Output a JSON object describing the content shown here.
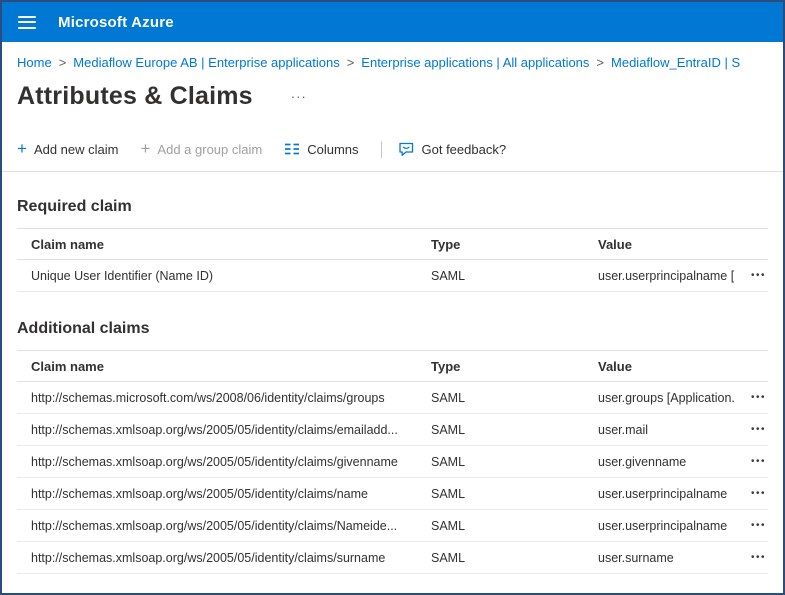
{
  "topbar": {
    "title": "Microsoft Azure"
  },
  "icons": {
    "add": "+",
    "more": "•••",
    "title_more": "···"
  },
  "breadcrumb": {
    "separator": ">",
    "items": [
      {
        "label": "Home"
      },
      {
        "label": "Mediaflow Europe AB | Enterprise applications"
      },
      {
        "label": "Enterprise applications | All applications"
      },
      {
        "label": "Mediaflow_EntraID | S"
      }
    ]
  },
  "page": {
    "title": "Attributes & Claims"
  },
  "toolbar": {
    "add_new_claim": "Add new claim",
    "add_group_claim": "Add a group claim",
    "columns": "Columns",
    "feedback": "Got feedback?"
  },
  "required_claim": {
    "section_title": "Required claim",
    "headers": {
      "claim_name": "Claim name",
      "type": "Type",
      "value": "Value"
    },
    "rows": [
      {
        "claim_name": "Unique User Identifier (Name ID)",
        "type": "SAML",
        "value": "user.userprincipalname [..."
      }
    ]
  },
  "additional_claims": {
    "section_title": "Additional claims",
    "headers": {
      "claim_name": "Claim name",
      "type": "Type",
      "value": "Value"
    },
    "rows": [
      {
        "claim_name": "http://schemas.microsoft.com/ws/2008/06/identity/claims/groups",
        "type": "SAML",
        "value": "user.groups [Application..."
      },
      {
        "claim_name": "http://schemas.xmlsoap.org/ws/2005/05/identity/claims/emailadd...",
        "type": "SAML",
        "value": "user.mail"
      },
      {
        "claim_name": "http://schemas.xmlsoap.org/ws/2005/05/identity/claims/givenname",
        "type": "SAML",
        "value": "user.givenname"
      },
      {
        "claim_name": "http://schemas.xmlsoap.org/ws/2005/05/identity/claims/name",
        "type": "SAML",
        "value": "user.userprincipalname"
      },
      {
        "claim_name": "http://schemas.xmlsoap.org/ws/2005/05/identity/claims/Nameide...",
        "type": "SAML",
        "value": "user.userprincipalname"
      },
      {
        "claim_name": "http://schemas.xmlsoap.org/ws/2005/05/identity/claims/surname",
        "type": "SAML",
        "value": "user.surname"
      }
    ]
  }
}
